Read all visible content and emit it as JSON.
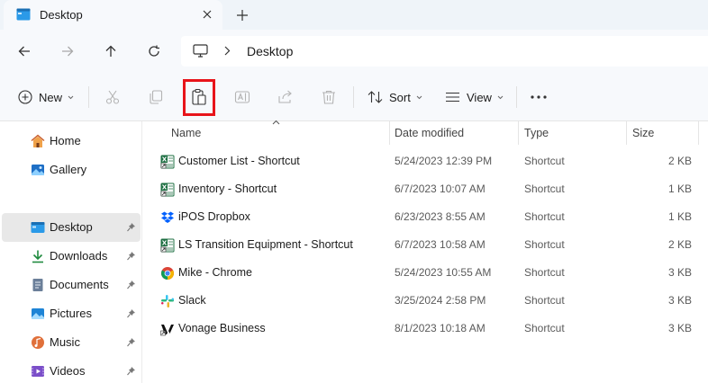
{
  "tab": {
    "title": "Desktop",
    "close": "✕",
    "add": "+"
  },
  "address": {
    "location": "Desktop"
  },
  "toolbar": {
    "new_label": "New",
    "sort_label": "Sort",
    "view_label": "View",
    "more": "···"
  },
  "sidebar": {
    "items": [
      {
        "label": "Home",
        "icon": "home-icon"
      },
      {
        "label": "Gallery",
        "icon": "gallery-icon"
      },
      {
        "label": "Desktop",
        "icon": "desktop-icon",
        "selected": true,
        "pinned": true
      },
      {
        "label": "Downloads",
        "icon": "downloads-icon",
        "pinned": true
      },
      {
        "label": "Documents",
        "icon": "documents-icon",
        "pinned": true
      },
      {
        "label": "Pictures",
        "icon": "pictures-icon",
        "pinned": true
      },
      {
        "label": "Music",
        "icon": "music-icon",
        "pinned": true
      },
      {
        "label": "Videos",
        "icon": "videos-icon",
        "pinned": true
      }
    ]
  },
  "columns": {
    "name": "Name",
    "date": "Date modified",
    "type": "Type",
    "size": "Size"
  },
  "files": [
    {
      "name": "Customer List - Shortcut",
      "date": "5/24/2023 12:39 PM",
      "type": "Shortcut",
      "size": "2 KB",
      "icon": "excel-shortcut-icon"
    },
    {
      "name": "Inventory - Shortcut",
      "date": "6/7/2023 10:07 AM",
      "type": "Shortcut",
      "size": "1 KB",
      "icon": "excel-shortcut-icon"
    },
    {
      "name": "iPOS Dropbox",
      "date": "6/23/2023 8:55 AM",
      "type": "Shortcut",
      "size": "1 KB",
      "icon": "dropbox-icon"
    },
    {
      "name": "LS Transition Equipment - Shortcut",
      "date": "6/7/2023 10:58 AM",
      "type": "Shortcut",
      "size": "2 KB",
      "icon": "excel-shortcut-icon"
    },
    {
      "name": "Mike - Chrome",
      "date": "5/24/2023 10:55 AM",
      "type": "Shortcut",
      "size": "3 KB",
      "icon": "chrome-icon"
    },
    {
      "name": "Slack",
      "date": "3/25/2024 2:58 PM",
      "type": "Shortcut",
      "size": "3 KB",
      "icon": "slack-icon"
    },
    {
      "name": "Vonage Business",
      "date": "8/1/2023 10:18 AM",
      "type": "Shortcut",
      "size": "3 KB",
      "icon": "vonage-icon"
    }
  ],
  "colors": {
    "highlight": "#e8141a",
    "accent": "#0067c0",
    "selected_bg": "#e8e8e8"
  }
}
